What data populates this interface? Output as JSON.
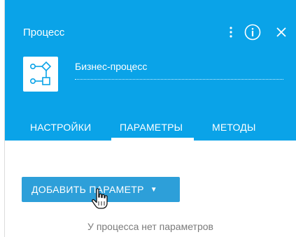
{
  "header": {
    "title": "Процесс",
    "more_icon": "vertical-dots-icon",
    "info_icon": "info-circle-icon",
    "close_icon": "close-icon",
    "bg_color": "#0aa3e8"
  },
  "process": {
    "icon": "business-process-icon",
    "name": "Бизнес-процесс"
  },
  "tabs": [
    {
      "label": "НАСТРОЙКИ",
      "active": false
    },
    {
      "label": "ПАРАМЕТРЫ",
      "active": true
    },
    {
      "label": "МЕТОДЫ",
      "active": false
    }
  ],
  "content": {
    "add_button_label": "ДОБАВИТЬ ПАРАМЕТР",
    "add_button_caret": "caret-down-icon",
    "cursor": "hand-pointer-icon",
    "empty_text": "У процесса нет параметров",
    "button_color": "#2d9fd9"
  }
}
